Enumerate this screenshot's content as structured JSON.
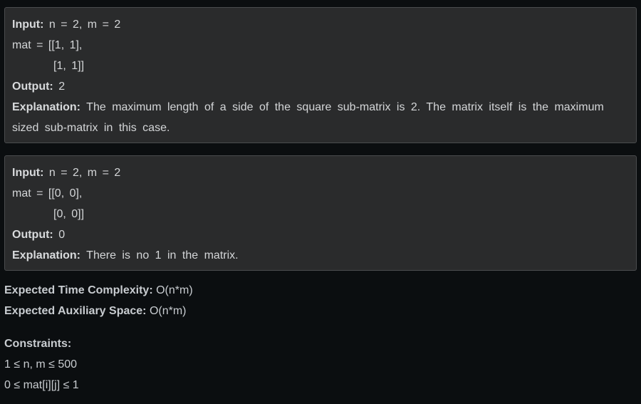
{
  "examples": [
    {
      "input_label": "Input:",
      "input_value": "n = 2, m = 2",
      "mat_row1": "mat = [[1, 1],",
      "mat_row2": "[1, 1]]",
      "output_label": "Output:",
      "output_value": "2",
      "explanation_label": "Explanation:",
      "explanation_text": "The maximum length of a side of the square sub-matrix is 2. The matrix itself is the maximum sized sub-matrix in this case."
    },
    {
      "input_label": "Input:",
      "input_value": "n = 2, m = 2",
      "mat_row1": "mat = [[0, 0],",
      "mat_row2": "[0, 0]]",
      "output_label": "Output:",
      "output_value": "0",
      "explanation_label": "Explanation:",
      "explanation_text": "There is no 1 in the matrix."
    }
  ],
  "complexity": {
    "time_label": "Expected Time Complexity:",
    "time_value": "O(n*m)",
    "space_label": "Expected Auxiliary Space:",
    "space_value": "O(n*m)"
  },
  "constraints": {
    "label": "Constraints:",
    "items": [
      "1 ≤ n, m ≤ 500",
      "0 ≤ mat[i][j] ≤ 1"
    ]
  }
}
